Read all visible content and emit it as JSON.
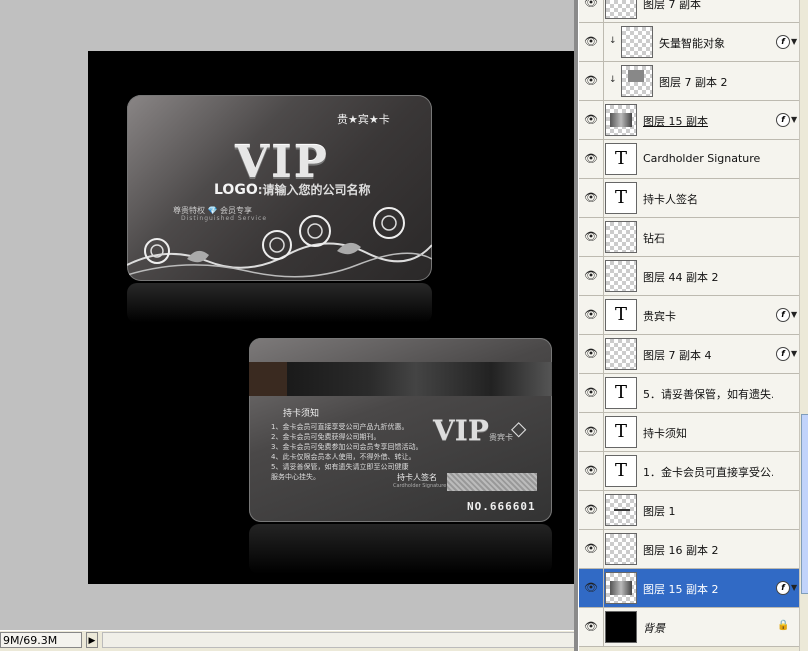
{
  "canvas": {
    "front_card": {
      "guest_title": "贵★宾★卡",
      "vip": "VIP",
      "logo_word": "LOGO",
      "logo_text": ":请输入您的公司名称",
      "privilege": "尊贵特权 💎 会员专享",
      "distinguished": "Distinguished Service"
    },
    "back_card": {
      "notice_title": "持卡须知",
      "notice_lines": [
        "1、金卡会员可直接享受公司产品九折优惠。",
        "2、金卡会员可免费获得公司期刊。",
        "3、金卡会员可免费参加公司会员专享回馈活动。",
        "4、此卡仅限会员本人使用，不得外借、转让。",
        "5、请妥善保管，如有遗失请立即至公司健康",
        "   服务中心挂失。"
      ],
      "vip": "VIP",
      "guest": "贵宾卡",
      "sign_label": "持卡人签名",
      "sign_en": "Cardholder Signature",
      "card_number": "NO.666601"
    }
  },
  "statusbar": {
    "doc_size": "9M/69.3M",
    "arrow": "▶"
  },
  "layers": [
    {
      "name": "图层 7 副本",
      "thumb": "checker",
      "indent": false,
      "fx": false
    },
    {
      "name": "矢量智能对象",
      "thumb": "checker",
      "indent": true,
      "fx": true
    },
    {
      "name": "图层 7 副本 2",
      "thumb": "gray",
      "indent": true,
      "fx": false
    },
    {
      "name": "图层 15 副本",
      "thumb": "grad",
      "indent": false,
      "fx": true,
      "underline": true
    },
    {
      "name": "Cardholder Signature",
      "thumb": "text",
      "indent": false,
      "fx": false
    },
    {
      "name": "持卡人签名",
      "thumb": "text",
      "indent": false,
      "fx": false
    },
    {
      "name": "钻石",
      "thumb": "checker",
      "indent": false,
      "fx": false
    },
    {
      "name": "图层 44 副本 2",
      "thumb": "checker",
      "indent": false,
      "fx": false
    },
    {
      "name": "贵宾卡",
      "thumb": "text",
      "indent": false,
      "fx": true
    },
    {
      "name": "图层 7 副本 4",
      "thumb": "checker",
      "indent": false,
      "fx": true
    },
    {
      "name": "5．请妥善保管，如有遗失...",
      "thumb": "text",
      "indent": false,
      "fx": false
    },
    {
      "name": "持卡须知",
      "thumb": "text",
      "indent": false,
      "fx": false
    },
    {
      "name": "1．金卡会员可直接享受公...",
      "thumb": "text",
      "indent": false,
      "fx": false
    },
    {
      "name": "图层 1",
      "thumb": "line",
      "indent": false,
      "fx": false
    },
    {
      "name": "图层 16 副本 2",
      "thumb": "checker",
      "indent": false,
      "fx": false
    },
    {
      "name": "图层 15 副本 2",
      "thumb": "grad",
      "indent": false,
      "fx": true,
      "selected": true
    },
    {
      "name": "背景",
      "thumb": "black",
      "indent": false,
      "fx": false,
      "locked": true,
      "italic": true
    }
  ],
  "icons": {
    "eye": "👁",
    "text_thumb": "T",
    "fx": "f",
    "fx_arrow": "▼",
    "lock": "🔒",
    "clip": "↓"
  }
}
